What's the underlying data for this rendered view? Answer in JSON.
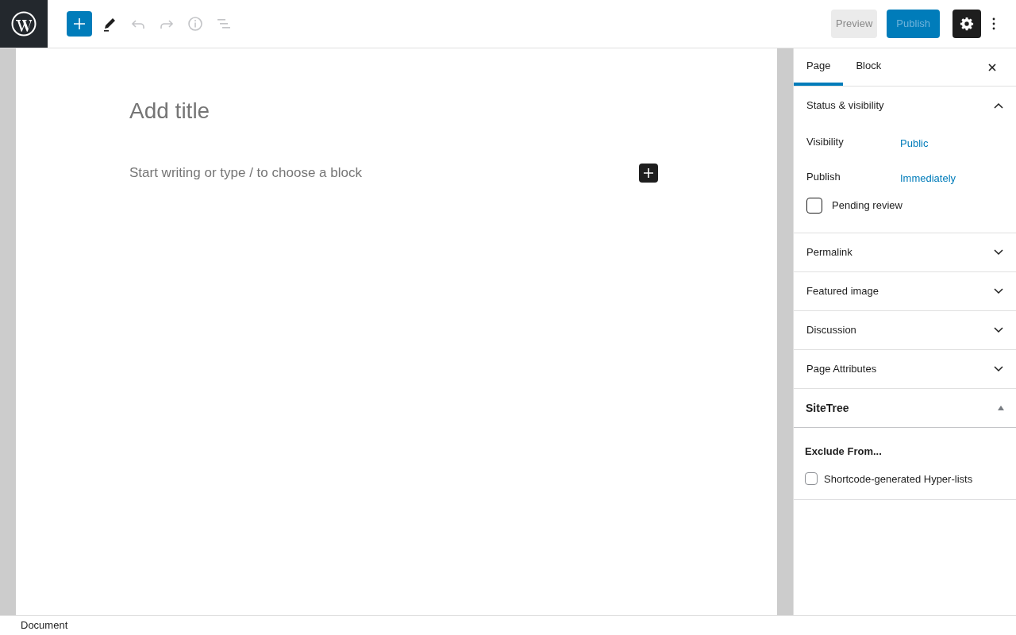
{
  "toolbar": {
    "tools": [
      {
        "kind": "edit",
        "disabled": false
      },
      {
        "kind": "undo",
        "disabled": true
      },
      {
        "kind": "redo",
        "disabled": true
      },
      {
        "kind": "info",
        "disabled": true
      },
      {
        "kind": "outline",
        "disabled": true
      }
    ],
    "preview": "Preview",
    "publish": "Publish",
    "settings_on": true
  },
  "editor": {
    "title_placeholder": "Add title",
    "body_placeholder": "Start writing or type / to choose a block"
  },
  "sidebar": {
    "tabs": [
      {
        "label": "Page",
        "selected": true
      },
      {
        "label": "Block",
        "selected": false
      }
    ],
    "status": {
      "title": "Status & visibility",
      "expanded": true,
      "fields": [
        {
          "label": "Visibility",
          "value": "Public"
        },
        {
          "label": "Publish",
          "value": "Immediately"
        }
      ],
      "pending": {
        "label": "Pending review",
        "checked": false
      }
    },
    "panels": [
      {
        "title": "Permalink",
        "expanded": false
      },
      {
        "title": "Featured image",
        "expanded": false
      },
      {
        "title": "Discussion",
        "expanded": false
      },
      {
        "title": "Page Attributes",
        "expanded": false
      }
    ],
    "sitetree": {
      "title": "SiteTree",
      "expanded": true,
      "heading": "Exclude From...",
      "options": [
        {
          "label": "Shortcode-generated Hyper-lists",
          "checked": false
        }
      ]
    }
  },
  "footer": "Document"
}
